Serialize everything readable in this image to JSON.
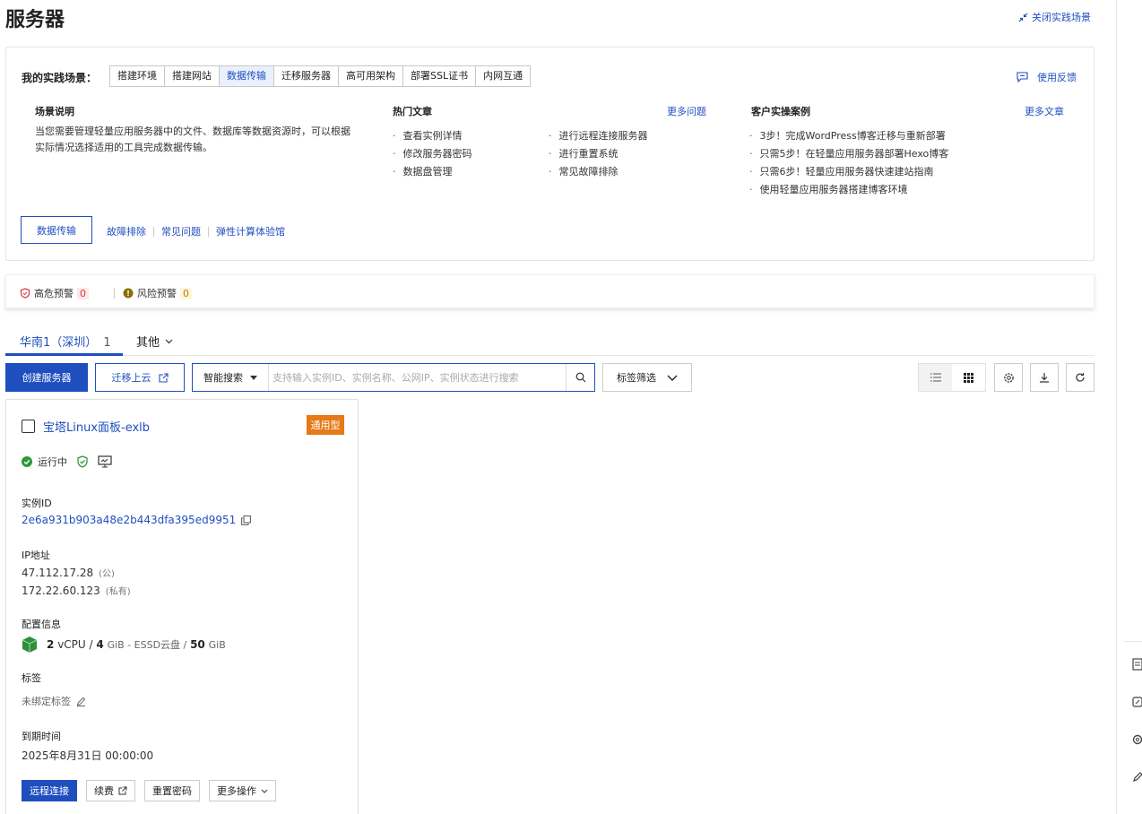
{
  "header": {
    "title": "服务器",
    "close_scene": "关闭实践场景"
  },
  "scene": {
    "label": "我的实践场景：",
    "tabs": [
      "搭建环境",
      "搭建网站",
      "数据传输",
      "迁移服务器",
      "高可用架构",
      "部署SSL证书",
      "内网互通"
    ],
    "active_tab": "数据传输",
    "feedback": "使用反馈",
    "desc_title": "场景说明",
    "desc_text": "当您需要管理轻量应用服务器中的文件、数据库等数据资源时，可以根据实际情况选择适用的工具完成数据传输。",
    "hot_title": "热门文章",
    "hot_more": "更多问题",
    "hot_col1": [
      "查看实例详情",
      "修改服务器密码",
      "数据盘管理"
    ],
    "hot_col2": [
      "进行远程连接服务器",
      "进行重置系统",
      "常见故障排除"
    ],
    "cases_title": "客户实操案例",
    "cases_more": "更多文章",
    "cases": [
      "3步！完成WordPress博客迁移与重新部署",
      "只需5步！在轻量应用服务器部署Hexo博客",
      "只需6步！轻量应用服务器快速建站指南",
      "使用轻量应用服务器搭建博客环境"
    ],
    "main_button": "数据传输",
    "links": [
      "故障排除",
      "常见问题",
      "弹性计算体验馆"
    ]
  },
  "alerts": {
    "high_label": "高危预警",
    "high_count": "0",
    "risk_label": "风险预警",
    "risk_count": "0"
  },
  "region": {
    "active": "华南1（深圳）",
    "active_count": "1",
    "other": "其他"
  },
  "toolbar": {
    "create": "创建服务器",
    "migrate": "迁移上云",
    "search_type": "智能搜索",
    "search_placeholder": "支持输入实例ID、实例名称、公网IP、实例状态进行搜索",
    "tag_filter": "标签筛选"
  },
  "instance": {
    "name": "宝塔Linux面板-exlb",
    "type_badge": "通用型",
    "status": "运行中",
    "id_label": "实例ID",
    "id": "2e6a931b903a48e2b443dfa395ed9951",
    "ip_label": "IP地址",
    "public_ip": "47.112.17.28",
    "public_tag": "(公)",
    "private_ip": "172.22.60.123",
    "private_tag": "(私有)",
    "config_label": "配置信息",
    "cpu": "2",
    "cpu_unit": "vCPU /",
    "mem": "4",
    "mem_unit": "GiB - ESSD云盘 /",
    "disk": "50",
    "disk_unit": "GiB",
    "tag_label": "标签",
    "tag_value": "未绑定标签",
    "expire_label": "到期时间",
    "expire": "2025年8月31日 00:00:00",
    "actions": {
      "connect": "远程连接",
      "renew": "续费",
      "reset_pwd": "重置密码",
      "more": "更多操作"
    }
  }
}
